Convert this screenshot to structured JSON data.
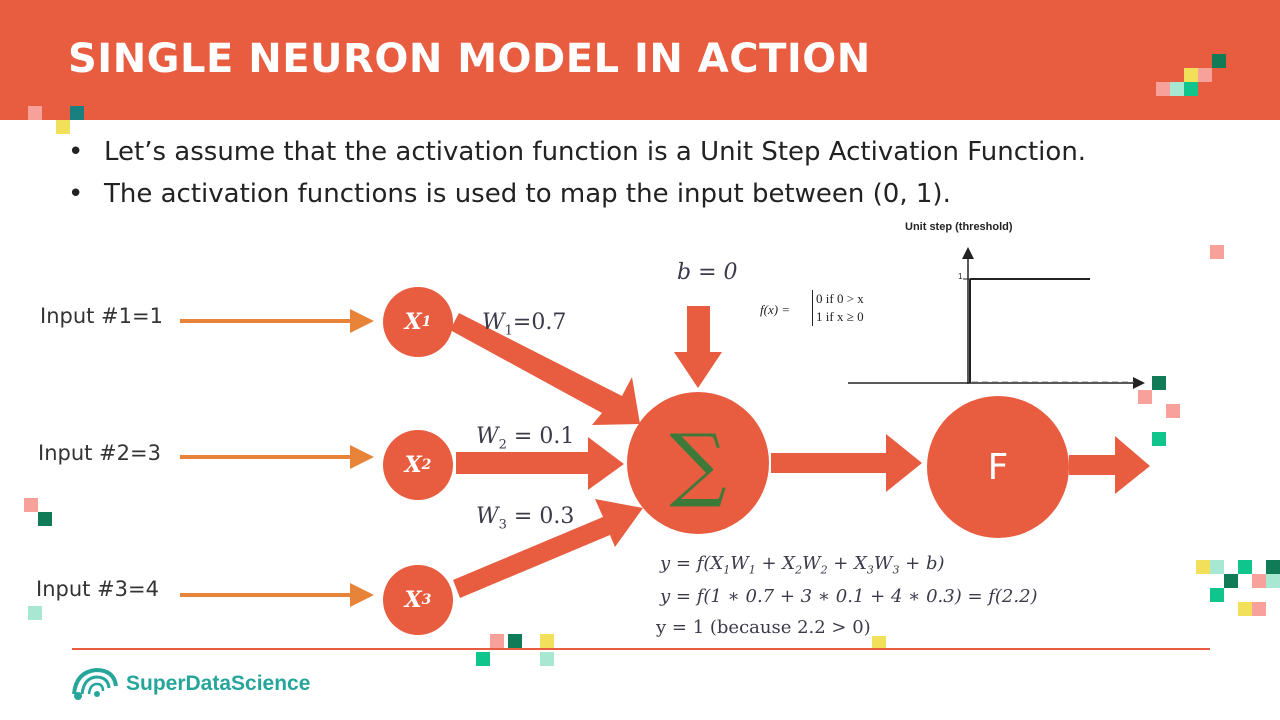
{
  "header": {
    "title": "SINGLE NEURON MODEL IN ACTION"
  },
  "bullets": [
    "Let’s assume that the activation function is a Unit Step Activation Function.",
    "The activation functions is used to map the input between (0, 1)."
  ],
  "inputs": [
    "Input #1=1",
    "Input #2=3",
    "Input #3=4"
  ],
  "nodes": {
    "x_symbol": "X",
    "x1_sub": "1",
    "x2_sub": "2",
    "x3_sub": "3",
    "sum_symbol": "∑",
    "f_label": "F"
  },
  "weights": {
    "w_symbol": "W",
    "w1_sub": "1",
    "w1_value": "=0.7",
    "w2_sub": "2",
    "w2_value": " = 0.1",
    "w3_sub": "3",
    "w3_value": " = 0.3"
  },
  "bias": "b = 0",
  "equations": {
    "line1_parts": [
      "y = f(X",
      "1",
      "W",
      "1",
      " + X",
      "2",
      "W",
      "2",
      " + X",
      "3",
      "W",
      "3",
      " + b)"
    ],
    "line2": "y = f(1 ∗ 0.7 + 3 ∗ 0.1 + 4 ∗ 0.3) = f(2.2)",
    "line3": "y = 1 (because 2.2 > 0)"
  },
  "step_chart": {
    "title": "Unit step (threshold)",
    "fx": "f(x) =",
    "case1": "0 if 0 > x",
    "case2": "1 if x ≥ 0",
    "y_tick": "1"
  },
  "footer": {
    "brand": "SuperDataScience"
  },
  "colors": {
    "accent": "#e85c3f",
    "input_arrow": "#e8833a",
    "sum_glyph": "#3d7a3a",
    "brand": "#26a69a"
  }
}
